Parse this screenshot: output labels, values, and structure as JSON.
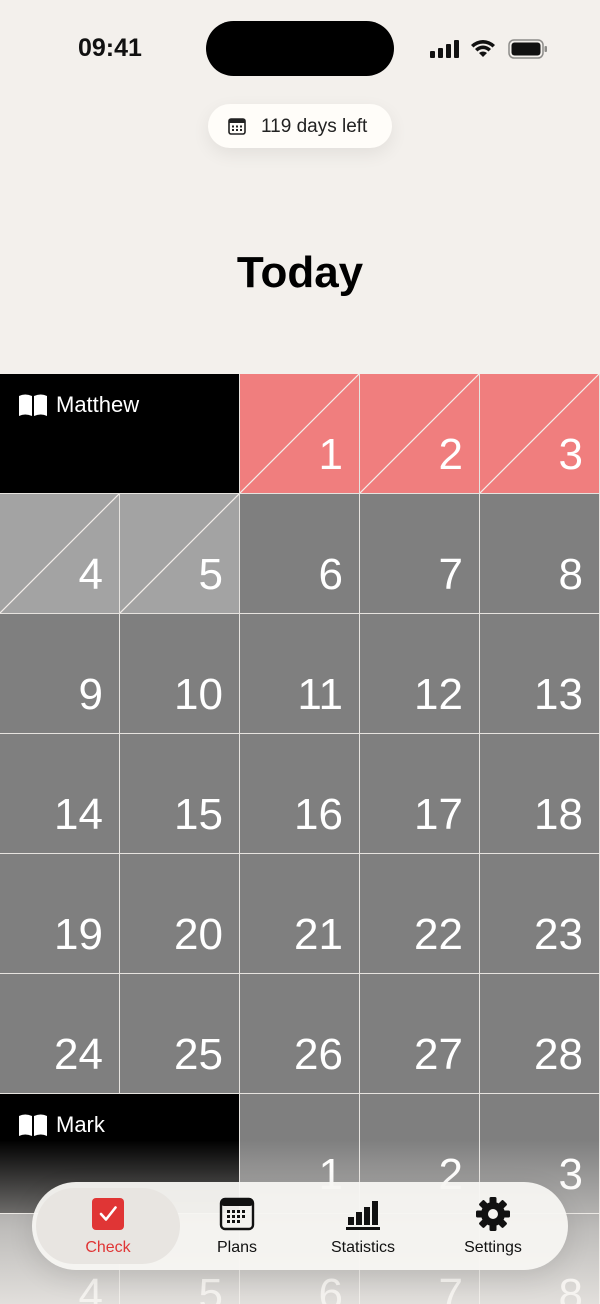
{
  "status": {
    "time": "09:41"
  },
  "header": {
    "days_left": "119 days left",
    "title": "Today"
  },
  "books": [
    {
      "name": "Matthew",
      "chapters": [
        "1",
        "2",
        "3",
        "4",
        "5",
        "6",
        "7",
        "8",
        "9",
        "10",
        "11",
        "12",
        "13",
        "14",
        "15",
        "16",
        "17",
        "18",
        "19",
        "20",
        "21",
        "22",
        "23",
        "24",
        "25",
        "26",
        "27",
        "28"
      ],
      "done": [
        "1",
        "2",
        "3"
      ],
      "partial": [
        "4",
        "5"
      ]
    },
    {
      "name": "Mark",
      "chapters": [
        "1",
        "2",
        "3",
        "4",
        "5",
        "6",
        "7",
        "8"
      ],
      "done": [],
      "partial": []
    }
  ],
  "tabs": [
    {
      "id": "check",
      "label": "Check",
      "icon": "checkbox-icon",
      "active": true
    },
    {
      "id": "plans",
      "label": "Plans",
      "icon": "calendar-icon",
      "active": false
    },
    {
      "id": "statistics",
      "label": "Statistics",
      "icon": "bar-chart-icon",
      "active": false
    },
    {
      "id": "settings",
      "label": "Settings",
      "icon": "gear-icon",
      "active": false
    }
  ],
  "colors": {
    "done": "#F07E7E",
    "partial": "#A3A3A3",
    "plain": "#7F7F7F",
    "accent": "#E03535"
  }
}
